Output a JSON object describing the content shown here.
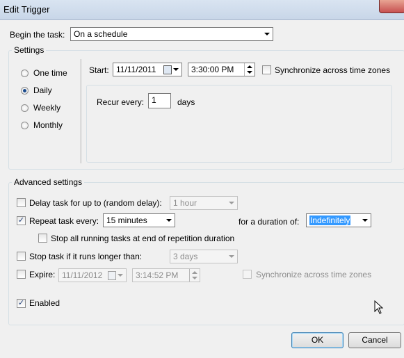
{
  "window": {
    "title": "Edit Trigger"
  },
  "begin": {
    "label": "Begin the task:",
    "value": "On a schedule"
  },
  "settings": {
    "legend": "Settings",
    "schedule_options": [
      {
        "label": "One time",
        "selected": false
      },
      {
        "label": "Daily",
        "selected": true
      },
      {
        "label": "Weekly",
        "selected": false
      },
      {
        "label": "Monthly",
        "selected": false
      }
    ],
    "start_label": "Start:",
    "start_date": "11/11/2011",
    "start_time": "3:30:00 PM",
    "sync_label": "Synchronize across time zones",
    "sync_checked": false,
    "recur_label": "Recur every:",
    "recur_value": "1",
    "recur_unit": "days"
  },
  "advanced": {
    "legend": "Advanced settings",
    "delay_label": "Delay task for up to (random delay):",
    "delay_checked": false,
    "delay_value": "1 hour",
    "repeat_label": "Repeat task every:",
    "repeat_checked": true,
    "repeat_value": "15 minutes",
    "duration_label": "for a duration of:",
    "duration_value": "Indefinitely",
    "stop_all_label": "Stop all running tasks at end of repetition duration",
    "stop_all_checked": false,
    "stop_if_label": "Stop task if it runs longer than:",
    "stop_if_checked": false,
    "stop_if_value": "3 days",
    "expire_label": "Expire:",
    "expire_checked": false,
    "expire_date": "11/11/2012",
    "expire_time": "3:14:52 PM",
    "expire_sync_label": "Synchronize across time zones",
    "enabled_label": "Enabled",
    "enabled_checked": true
  },
  "buttons": {
    "ok": "OK",
    "cancel": "Cancel"
  },
  "colors": {
    "selection": "#3399ff",
    "check": "#21407a"
  }
}
